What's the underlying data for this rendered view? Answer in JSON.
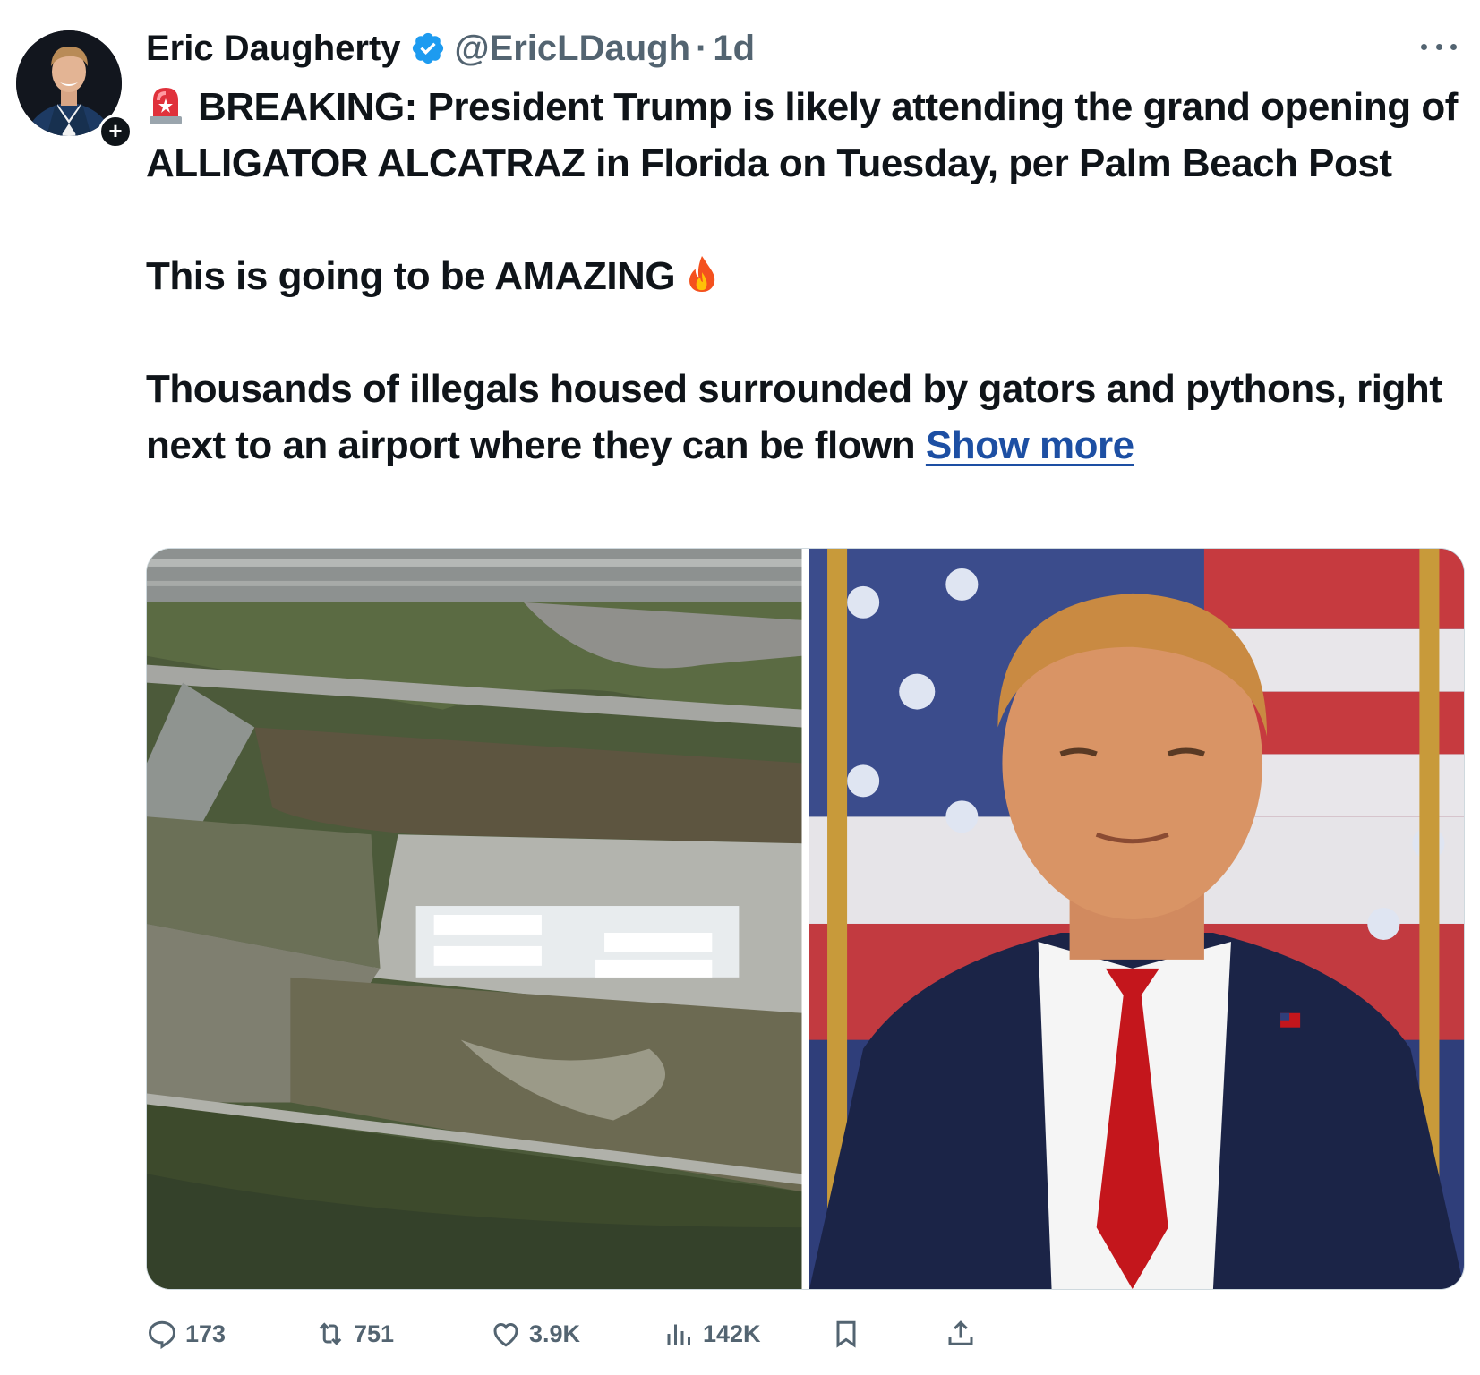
{
  "author": {
    "display_name": "Eric Daugherty",
    "handle": "@EricLDaugh",
    "separator": "·",
    "time": "1d",
    "verified": true,
    "verified_color": "#1d9bf0"
  },
  "post": {
    "paragraph1": "BREAKING: President Trump is likely attending the grand opening of ALLIGATOR ALCATRAZ in Florida on Tuesday, per Palm Beach Post",
    "paragraph2": "This is going to be AMAZING",
    "paragraph3": "Thousands of illegals housed surrounded by gators and pythons, right next to an airport where they can be flown",
    "show_more": "Show more",
    "link_color": "#1d4fa3"
  },
  "icons": {
    "menu": "more-icon",
    "badge": "verified-badge-icon",
    "follow": "follow-plus-icon",
    "lead_emoji": "police-siren-emoji",
    "trail_emoji": "fire-emoji"
  },
  "media": [
    {
      "name": "aerial-photo",
      "kind": "aerial view of airstrip facility with white tents"
    },
    {
      "name": "portrait-photo",
      "kind": "man in suit and red tie before american flag"
    }
  ],
  "actions": {
    "replies": "173",
    "reposts": "751",
    "likes": "3.9K",
    "views": "142K"
  },
  "colors": {
    "text": "#0f1419",
    "secondary": "#536471"
  }
}
